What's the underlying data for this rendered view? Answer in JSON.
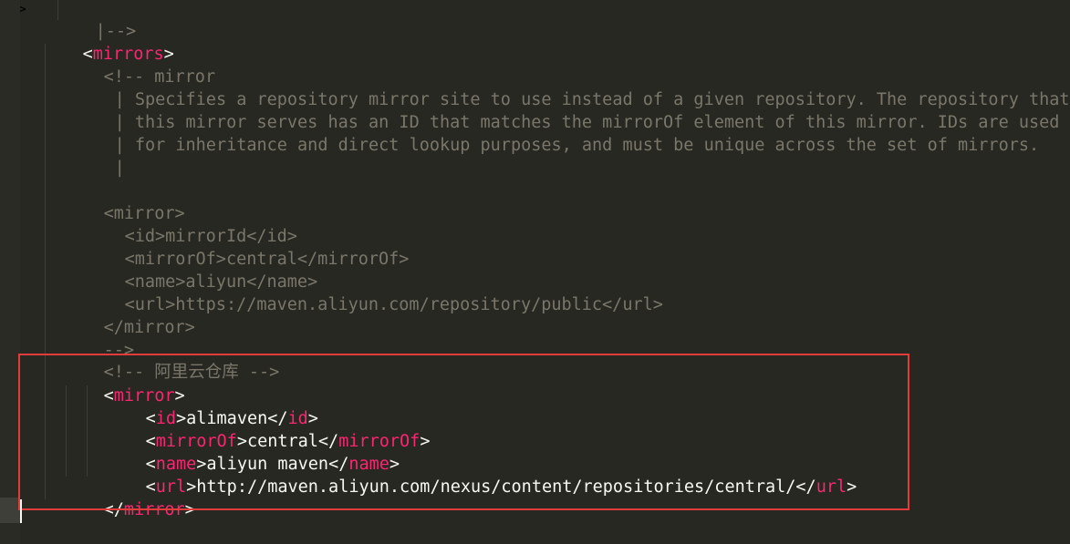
{
  "editor": {
    "lines": [
      {
        "text": "|-->"
      },
      {
        "open": "<",
        "tag": "mirrors",
        "close": ">"
      },
      {
        "text": "<!-- mirror"
      },
      {
        "text": "| Specifies a repository mirror site to use instead of a given repository. The repository that"
      },
      {
        "text": "| this mirror serves has an ID that matches the mirrorOf element of this mirror. IDs are used"
      },
      {
        "text": "| for inheritance and direct lookup purposes, and must be unique across the set of mirrors."
      },
      {
        "text": "|"
      },
      {
        "text": "<mirror>"
      },
      {
        "text": "<id>mirrorId</id>"
      },
      {
        "text": "<mirrorOf>central</mirrorOf>"
      },
      {
        "text": "<name>aliyun</name>"
      },
      {
        "text": "<url>https://maven.aliyun.com/repository/public</url>"
      },
      {
        "text": "</mirror>"
      },
      {
        "text": "-->"
      },
      {
        "text": "<!-- 阿里云仓库 -->"
      },
      {
        "open": "<",
        "tag": "mirror",
        "close": ">"
      },
      {
        "open": "<",
        "tag": "id",
        "close": ">",
        "value": "alimaven",
        "end_open": "</",
        "end_tag": "id",
        "end_close": ">"
      },
      {
        "open": "<",
        "tag": "mirrorOf",
        "close": ">",
        "value": "central",
        "end_open": "</",
        "end_tag": "mirrorOf",
        "end_close": ">"
      },
      {
        "open": "<",
        "tag": "name",
        "close": ">",
        "value": "aliyun maven",
        "end_open": "</",
        "end_tag": "name",
        "end_close": ">"
      },
      {
        "open": "<",
        "tag": "url",
        "close": ">",
        "value": "http://maven.aliyun.com/nexus/content/repositories/central/",
        "end_open": "</",
        "end_tag": "url",
        "end_close": ">"
      },
      {
        "open": "</",
        "tag": "mirror",
        "close": ">"
      }
    ]
  },
  "colors": {
    "background": "#272822",
    "comment": "#7a776a",
    "tag": "#f92672",
    "text": "#f8f8f2",
    "highlight_border": "#e23b3b"
  }
}
